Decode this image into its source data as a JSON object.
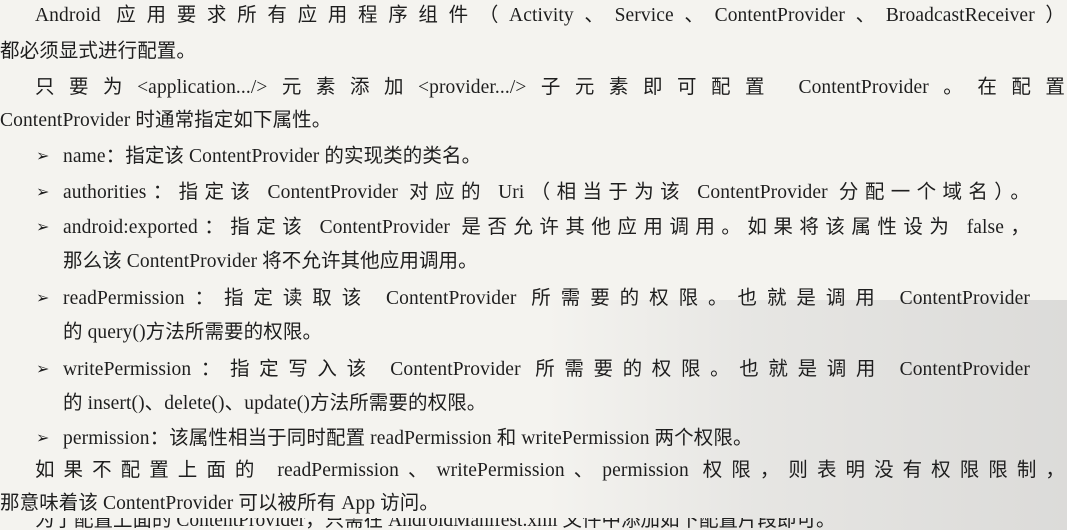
{
  "paragraphs": {
    "p1_line1": "Android 应用要求所有应用程序组件（Activity、Service、ContentProvider、BroadcastReceiver）",
    "p1_line2": "都必须显式进行配置。",
    "p2_line1": "只要为<application.../>元素添加<provider.../>子元素即可配置 ContentProvider。在配置",
    "p2_line2": "ContentProvider 时通常指定如下属性。"
  },
  "bullets": {
    "marker": "➢",
    "b1_line1": "name：指定该 ContentProvider 的实现类的类名。",
    "b2_line1": "authorities：指定该 ContentProvider 对应的 Uri（相当于为该 ContentProvider 分配一个域名）。",
    "b3_line1": "android:exported：指定该 ContentProvider 是否允许其他应用调用。如果将该属性设为 false，",
    "b3_line2": "那么该 ContentProvider 将不允许其他应用调用。",
    "b4_line1": "readPermission：指定读取该 ContentProvider 所需要的权限。也就是调用 ContentProvider",
    "b4_line2": "的 query()方法所需要的权限。",
    "b5_line1": "writePermission：指定写入该 ContentProvider 所需要的权限。也就是调用 ContentProvider",
    "b5_line2": "的 insert()、delete()、update()方法所需要的权限。",
    "b6_line1": "permission：该属性相当于同时配置 readPermission 和 writePermission 两个权限。"
  },
  "closing": {
    "line1": "如果不配置上面的 readPermission、writePermission、permission 权限，则表明没有权限限制，",
    "line2": "那意味着该 ContentProvider 可以被所有 App 访问。",
    "cut_line": "为了配置上面的 ContentProvider，只需在 AndroidManifest.xml 文件中添加如下配置片段即可。"
  }
}
